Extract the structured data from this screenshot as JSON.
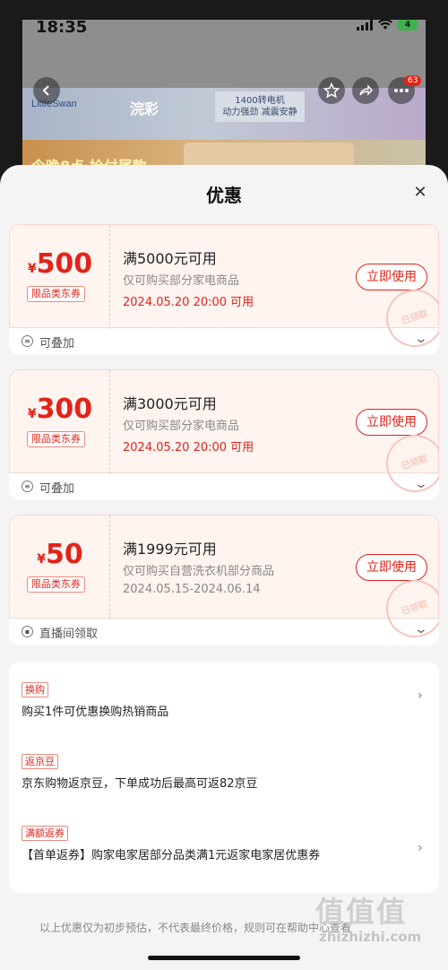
{
  "status_bar": {
    "time": "18:35",
    "battery": "4"
  },
  "background_page": {
    "brand_text": "LittleSwan",
    "logo_text": "浣彩",
    "banner_tag_line1": "1400转电机",
    "banner_tag_line2": "动力强劲 减震安静",
    "promo_text": "今晚8点 抢付尾款",
    "cart_badge": "63"
  },
  "sheet": {
    "title": "优惠",
    "close_icon": "close-icon"
  },
  "coupons": [
    {
      "currency": "¥",
      "amount": "500",
      "limit_tag": "限品类东券",
      "condition": "满5000元可用",
      "scope": "仅可购买部分家电商品",
      "validity": "2024.05.20 20:00 可用",
      "button": "立即使用",
      "stamp": "已领取",
      "footer": "可叠加"
    },
    {
      "currency": "¥",
      "amount": "300",
      "limit_tag": "限品类东券",
      "condition": "满3000元可用",
      "scope": "仅可购买部分家电商品",
      "validity": "2024.05.20 20:00 可用",
      "button": "立即使用",
      "stamp": "已领取",
      "footer": "可叠加"
    },
    {
      "currency": "¥",
      "amount": "50",
      "limit_tag": "限品类东券",
      "condition": "满1999元可用",
      "scope": "仅可购买自营洗衣机部分商品",
      "validity": "2024.05.15-2024.06.14",
      "button": "立即使用",
      "stamp": "已领取",
      "footer": "直播间领取"
    }
  ],
  "benefits": [
    {
      "tag": "换购",
      "text": "购买1件可优惠换购热销商品"
    },
    {
      "tag": "返京豆",
      "text": "京东购物返京豆，下单成功后最高可返82京豆"
    },
    {
      "tag": "满额返券",
      "text": "【首单返券】购家电家居部分品类满1元返家电家居优惠券"
    }
  ],
  "disclaimer": "以上优惠仅为初步预估，不代表最终价格，规则可在帮助中心查看",
  "watermark": {
    "main": "值值值",
    "sub": "zhizhizhi.com"
  },
  "colors": {
    "accent": "#e2231a",
    "coupon_bg": "#fff4f0",
    "sheet_bg": "#f4f4f4"
  }
}
